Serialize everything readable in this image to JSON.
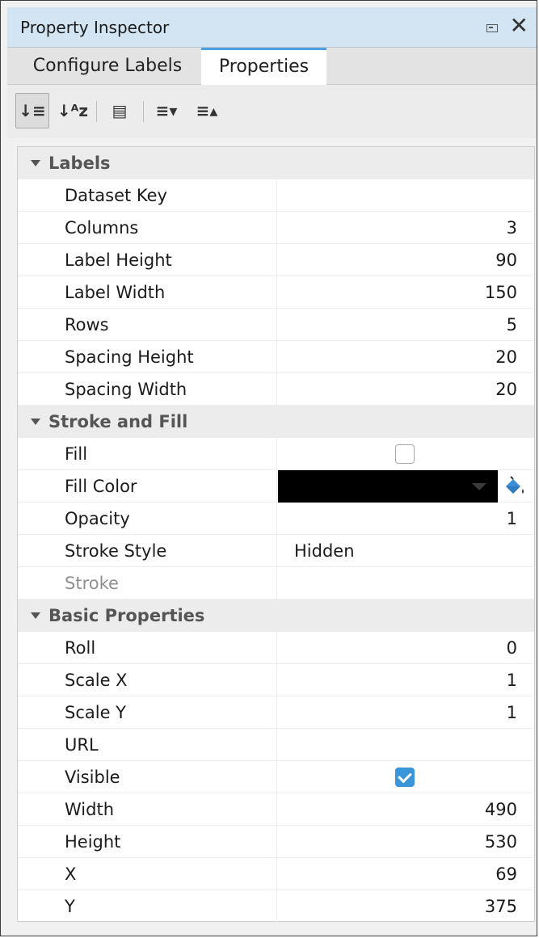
{
  "window": {
    "title": "Property Inspector",
    "restore_icon": "restore-window-icon",
    "close_icon": "close-icon",
    "close_glyph": "✕"
  },
  "tabs": [
    {
      "label": "Configure Labels",
      "active": false
    },
    {
      "label": "Properties",
      "active": true
    }
  ],
  "toolbar": [
    {
      "icon": "sort-categorized-icon",
      "glyph": "↓≡",
      "active": true
    },
    {
      "icon": "sort-alphabetical-icon",
      "glyph": "↓ᴬz",
      "active": false
    },
    {
      "icon": "show-descriptions-icon",
      "glyph": "▤",
      "active": false
    },
    {
      "icon": "expand-all-icon",
      "glyph": "≡▾",
      "active": false
    },
    {
      "icon": "collapse-all-icon",
      "glyph": "≡▴",
      "active": false
    }
  ],
  "groups": {
    "labels": {
      "title": "Labels",
      "rows": [
        {
          "name": "Dataset Key",
          "value": ""
        },
        {
          "name": "Columns",
          "value": "3"
        },
        {
          "name": "Label Height",
          "value": "90"
        },
        {
          "name": "Label Width",
          "value": "150"
        },
        {
          "name": "Rows",
          "value": "5"
        },
        {
          "name": "Spacing Height",
          "value": "20"
        },
        {
          "name": "Spacing Width",
          "value": "20"
        }
      ]
    },
    "stroke_fill": {
      "title": "Stroke and Fill",
      "fill": {
        "name": "Fill",
        "checked": false
      },
      "fill_color": {
        "name": "Fill Color",
        "color": "#000000",
        "icon": "paint-bucket-icon"
      },
      "opacity": {
        "name": "Opacity",
        "value": "1"
      },
      "stroke_style": {
        "name": "Stroke Style",
        "value": "Hidden"
      },
      "stroke": {
        "name": "Stroke",
        "value": "",
        "disabled": true
      }
    },
    "basic": {
      "title": "Basic Properties",
      "roll": {
        "name": "Roll",
        "value": "0"
      },
      "scale_x": {
        "name": "Scale X",
        "value": "1"
      },
      "scale_y": {
        "name": "Scale Y",
        "value": "1"
      },
      "url": {
        "name": "URL",
        "value": ""
      },
      "visible": {
        "name": "Visible",
        "checked": true
      },
      "width": {
        "name": "Width",
        "value": "490"
      },
      "height": {
        "name": "Height",
        "value": "530"
      },
      "x": {
        "name": "X",
        "value": "69"
      },
      "y": {
        "name": "Y",
        "value": "375"
      }
    }
  },
  "colors": {
    "accent": "#4c9fe0",
    "title_bar": "#d3e5f3",
    "checkbox_checked": "#3b95d9"
  }
}
